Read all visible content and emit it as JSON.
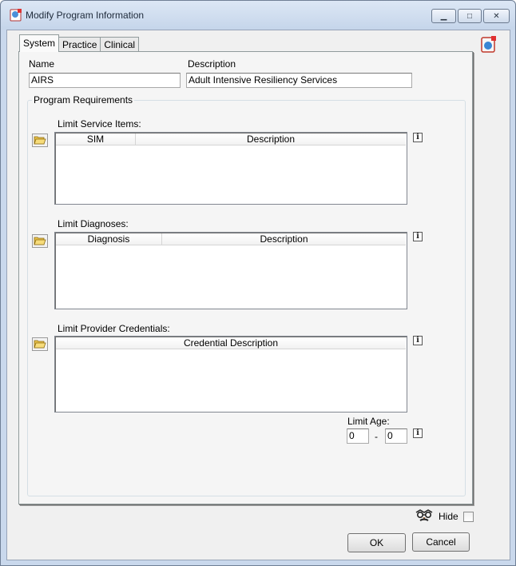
{
  "window": {
    "title": "Modify Program Information",
    "controls": {
      "minimize_glyph": "▁",
      "maximize_glyph": "□",
      "close_glyph": "✕"
    }
  },
  "tabs": [
    {
      "label": "System",
      "active": true
    },
    {
      "label": "Practice",
      "active": false
    },
    {
      "label": "Clinical",
      "active": false
    }
  ],
  "system": {
    "name_label": "Name",
    "name_value": "AIRS",
    "description_label": "Description",
    "description_value": "Adult Intensive Resiliency Services",
    "group_title": "Program Requirements",
    "service_items": {
      "label": "Limit Service Items:",
      "columns": [
        "SIM",
        "Description"
      ],
      "rows": []
    },
    "diagnoses": {
      "label": "Limit Diagnoses:",
      "columns": [
        "Diagnosis",
        "Description"
      ],
      "rows": []
    },
    "credentials": {
      "label": "Limit Provider Credentials:",
      "columns": [
        "Credential Description"
      ],
      "rows": []
    },
    "age": {
      "label": "Limit Age:",
      "min": "0",
      "separator": "-",
      "max": "0"
    },
    "info_glyph": "i"
  },
  "footer": {
    "hide_label": "Hide",
    "hide_checked": false,
    "ok_label": "OK",
    "cancel_label": "Cancel"
  },
  "icons": [
    "app-icon",
    "help-book-icon",
    "folder-open-icon",
    "info-icon",
    "disguise-glasses-icon"
  ],
  "colors": {
    "titlebar": "#c9d8ec",
    "dialog_bg": "#f0f0f0",
    "tab_panel": "#f5f5f5"
  }
}
